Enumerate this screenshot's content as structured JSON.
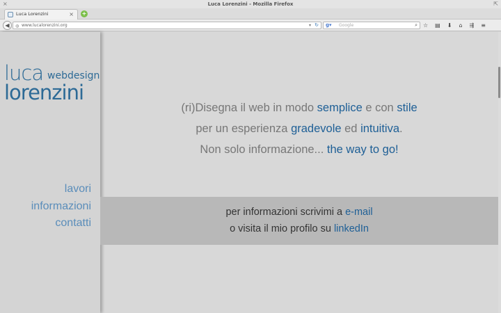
{
  "window": {
    "title": "Luca Lorenzini - Mozilla Firefox"
  },
  "tab": {
    "label": "Luca Lorenzini"
  },
  "nav": {
    "url": "www.lucalorenzini.org",
    "search_placeholder": "Google"
  },
  "logo": {
    "line1": "luca",
    "line2": "webdesign",
    "line3": "lorenzini"
  },
  "menu": {
    "items": [
      "lavori",
      "informazioni",
      "contatti"
    ]
  },
  "hero": {
    "l1a": "(ri)Disegna il web in modo ",
    "l1b": "semplice",
    "l1c": " e con ",
    "l1d": "stile",
    "l2a": "per un esperienza ",
    "l2b": "gradevole",
    "l2c": " ed ",
    "l2d": "intuitiva",
    "l2e": ".",
    "l3a": "Non solo informazione... ",
    "l3b": "the way to go!"
  },
  "contact": {
    "l1a": "per informazioni scrivimi a ",
    "l1b": "e-mail",
    "l2a": "o visita il mio profilo su ",
    "l2b": "linkedIn"
  },
  "colors": {
    "accent": "#1e5f96",
    "menu": "#5a8dba",
    "band": "#b8b8b8"
  }
}
